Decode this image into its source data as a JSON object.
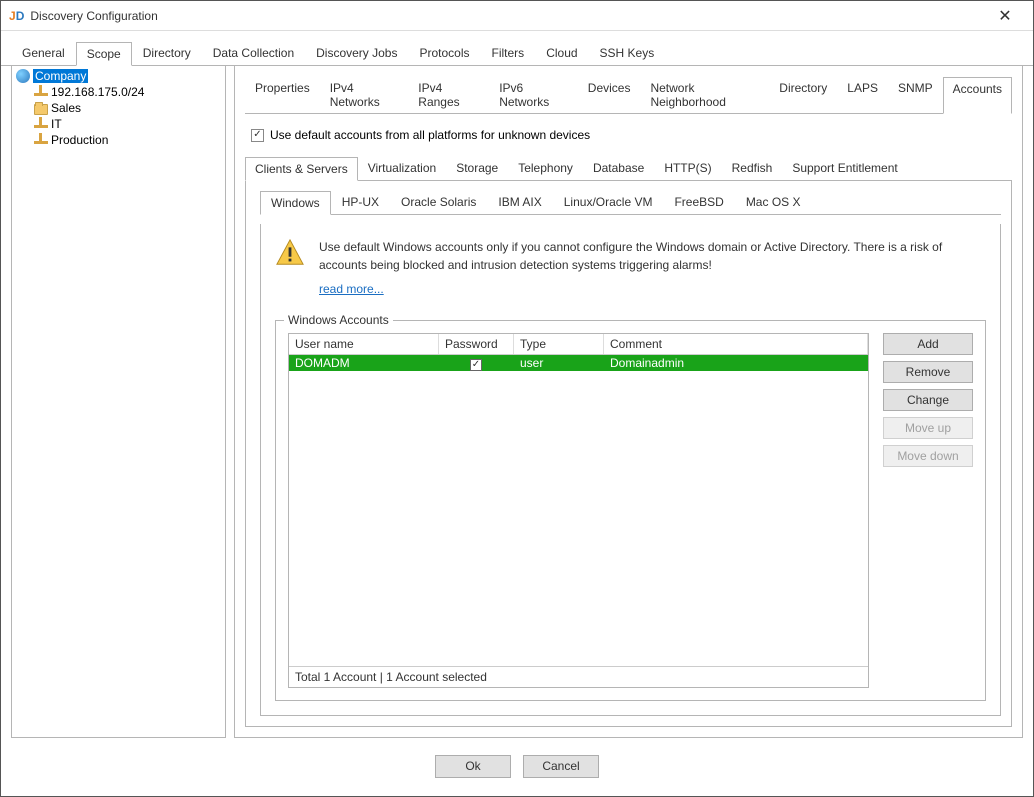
{
  "window": {
    "title": "Discovery Configuration"
  },
  "main_tabs": [
    "General",
    "Scope",
    "Directory",
    "Data Collection",
    "Discovery Jobs",
    "Protocols",
    "Filters",
    "Cloud",
    "SSH Keys"
  ],
  "main_tabs_active": "Scope",
  "tree": {
    "root": "Company",
    "children": [
      {
        "label": "192.168.175.0/24",
        "icon": "net"
      },
      {
        "label": "Sales",
        "icon": "folder"
      },
      {
        "label": "IT",
        "icon": "net"
      },
      {
        "label": "Production",
        "icon": "net"
      }
    ]
  },
  "sub_tabs": [
    "Properties",
    "IPv4 Networks",
    "IPv4 Ranges",
    "IPv6 Networks",
    "Devices",
    "Network Neighborhood",
    "Directory",
    "LAPS",
    "SNMP",
    "Accounts"
  ],
  "sub_tabs_active": "Accounts",
  "checkbox_label": "Use default accounts from all platforms for unknown devices",
  "cat_tabs": [
    "Clients & Servers",
    "Virtualization",
    "Storage",
    "Telephony",
    "Database",
    "HTTP(S)",
    "Redfish",
    "Support Entitlement"
  ],
  "cat_tabs_active": "Clients & Servers",
  "os_tabs": [
    "Windows",
    "HP-UX",
    "Oracle Solaris",
    "IBM AIX",
    "Linux/Oracle VM",
    "FreeBSD",
    "Mac OS X"
  ],
  "os_tabs_active": "Windows",
  "warning_text": "Use default Windows accounts only if you cannot configure the Windows domain or Active Directory. There is a risk of accounts being blocked and intrusion detection systems triggering alarms!",
  "read_more": "read more...",
  "fieldset_title": "Windows Accounts",
  "grid": {
    "headers": {
      "user": "User name",
      "password": "Password",
      "type": "Type",
      "comment": "Comment"
    },
    "rows": [
      {
        "user": "DOMADM",
        "password_checked": true,
        "type": "user",
        "comment": "Domainadmin"
      }
    ],
    "footer": "Total 1 Account | 1 Account selected"
  },
  "buttons": {
    "add": "Add",
    "remove": "Remove",
    "change": "Change",
    "moveup": "Move up",
    "movedown": "Move down"
  },
  "footer": {
    "ok": "Ok",
    "cancel": "Cancel"
  }
}
